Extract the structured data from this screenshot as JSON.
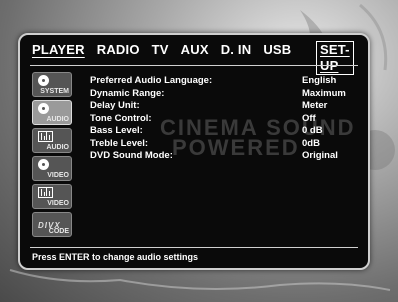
{
  "tabs": [
    {
      "label": "PLAYER",
      "active": true
    },
    {
      "label": "RADIO"
    },
    {
      "label": "TV"
    },
    {
      "label": "AUX"
    },
    {
      "label": "D. IN"
    },
    {
      "label": "USB"
    }
  ],
  "setup_tab": {
    "label": "SET-UP"
  },
  "sidebar": [
    {
      "label": "SYSTEM",
      "icon": "disc-icon"
    },
    {
      "label": "AUDIO",
      "icon": "disc-icon",
      "selected": true
    },
    {
      "label": "AUDIO",
      "icon": "equalizer-icon"
    },
    {
      "label": "VIDEO",
      "icon": "disc-icon"
    },
    {
      "label": "VIDEO",
      "icon": "equalizer-icon"
    },
    {
      "label": "CODE",
      "icon": "divx-logo",
      "logo_text": "DIVX"
    }
  ],
  "settings": [
    {
      "label": "Preferred Audio Language:",
      "value": "English"
    },
    {
      "label": "Dynamic Range:",
      "value": "Maximum"
    },
    {
      "label": "Delay Unit:",
      "value": "Meter"
    },
    {
      "label": "Tone Control:",
      "value": "Off"
    },
    {
      "label": "Bass Level:",
      "value": "0 dB"
    },
    {
      "label": "Treble Level:",
      "value": "0dB"
    },
    {
      "label": "DVD Sound Mode:",
      "value": "Original"
    }
  ],
  "watermark": {
    "line1": "CINEMA SOUND",
    "line2": "POWERED"
  },
  "status": "Press ENTER to change audio settings",
  "colors": {
    "panel": "#0a0a0a",
    "text": "#ffffff",
    "border": "#cfcfcf"
  }
}
